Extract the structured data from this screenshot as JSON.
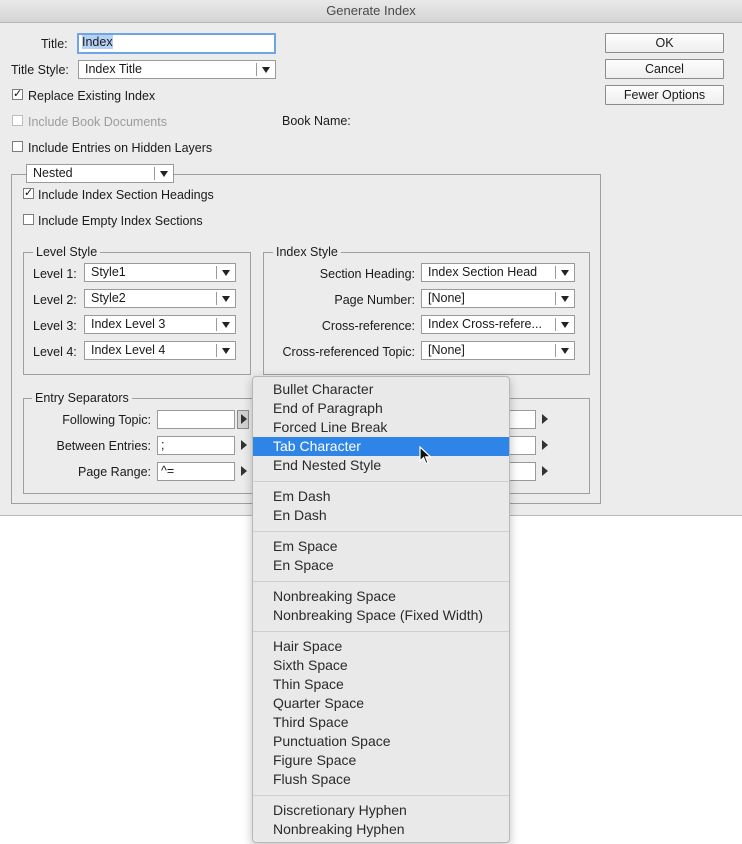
{
  "window": {
    "title": "Generate Index"
  },
  "form": {
    "title_label": "Title:",
    "title_value": "Index",
    "title_style_label": "Title Style:",
    "title_style_value": "Index Title",
    "replace_existing_label": "Replace Existing Index",
    "replace_existing_checked": true,
    "include_book_docs_label": "Include Book Documents",
    "include_book_docs_checked": false,
    "book_name_label": "Book Name:",
    "hidden_layers_label": "Include Entries on Hidden Layers",
    "hidden_layers_checked": false
  },
  "buttons": {
    "ok": "OK",
    "cancel": "Cancel",
    "fewer_options": "Fewer Options"
  },
  "options": {
    "format_value": "Nested",
    "section_headings_label": "Include Index Section Headings",
    "section_headings_checked": true,
    "empty_sections_label": "Include Empty Index Sections",
    "empty_sections_checked": false
  },
  "level_style": {
    "title": "Level Style",
    "levels": [
      {
        "label": "Level 1:",
        "value": "Style1"
      },
      {
        "label": "Level 2:",
        "value": "Style2"
      },
      {
        "label": "Level 3:",
        "value": "Index Level 3"
      },
      {
        "label": "Level 4:",
        "value": "Index Level 4"
      }
    ]
  },
  "index_style": {
    "title": "Index Style",
    "rows": [
      {
        "label": "Section Heading:",
        "value": "Index Section Head"
      },
      {
        "label": "Page Number:",
        "value": "[None]"
      },
      {
        "label": "Cross-reference:",
        "value": "Index Cross-refere..."
      },
      {
        "label": "Cross-referenced Topic:",
        "value": "[None]"
      }
    ]
  },
  "entry_separators": {
    "title": "Entry Separators",
    "rows": [
      {
        "label": "Following Topic:",
        "value": ""
      },
      {
        "label": "Between Entries:",
        "value": ";"
      },
      {
        "label": "Page Range:",
        "value": "^="
      }
    ]
  },
  "menu": {
    "highlighted": "Tab Character",
    "groups": [
      [
        "Bullet Character",
        "End of Paragraph",
        "Forced Line Break",
        "Tab Character",
        "End Nested Style"
      ],
      [
        "Em Dash",
        "En Dash"
      ],
      [
        "Em Space",
        "En Space"
      ],
      [
        "Nonbreaking Space",
        "Nonbreaking Space (Fixed Width)"
      ],
      [
        "Hair Space",
        "Sixth Space",
        "Thin Space",
        "Quarter Space",
        "Third Space",
        "Punctuation Space",
        "Figure Space",
        "Flush Space"
      ],
      [
        "Discretionary Hyphen",
        "Nonbreaking Hyphen"
      ]
    ]
  },
  "colors": {
    "highlight": "#2f84e8",
    "dialog_bg": "#ececec",
    "focus_ring": "#6fa4e6"
  }
}
